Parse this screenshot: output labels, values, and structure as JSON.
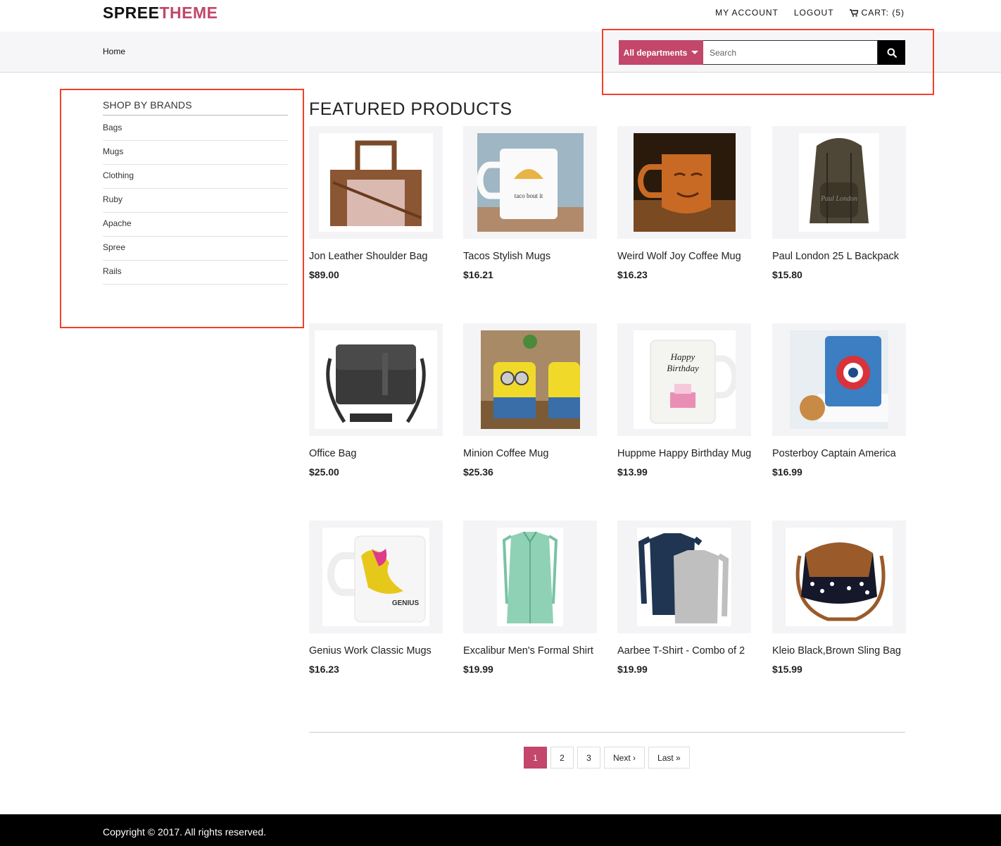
{
  "brand": {
    "part1": "SPREE",
    "part2": "THEME"
  },
  "top_links": {
    "account": "MY ACCOUNT",
    "logout": "LOGOUT",
    "cart": "CART: (5)"
  },
  "nav": {
    "home": "Home"
  },
  "search": {
    "department": "All departments",
    "placeholder": "Search"
  },
  "sidebar": {
    "title": "SHOP BY BRANDS",
    "items": [
      "Bags",
      "Mugs",
      "Clothing",
      "Ruby",
      "Apache",
      "Spree",
      "Rails"
    ]
  },
  "main": {
    "title": "FEATURED PRODUCTS"
  },
  "products": [
    {
      "name": "Jon Leather Shoulder Bag",
      "price": "$89.00",
      "icon": "shoulder-bag"
    },
    {
      "name": "Tacos Stylish Mugs",
      "price": "$16.21",
      "icon": "mug"
    },
    {
      "name": "Weird Wolf Joy Coffee Mug",
      "price": "$16.23",
      "icon": "mug"
    },
    {
      "name": "Paul London 25 L Backpack",
      "price": "$15.80",
      "icon": "backpack"
    },
    {
      "name": "Office Bag",
      "price": "$25.00",
      "icon": "messenger-bag"
    },
    {
      "name": "Minion Coffee Mug",
      "price": "$25.36",
      "icon": "mug"
    },
    {
      "name": "Huppme Happy Birthday Mug",
      "price": "$13.99",
      "icon": "mug"
    },
    {
      "name": "Posterboy Captain America",
      "price": "$16.99",
      "icon": "mug"
    },
    {
      "name": "Genius Work Classic Mugs",
      "price": "$16.23",
      "icon": "mug"
    },
    {
      "name": "Excalibur Men's Formal Shirt",
      "price": "$19.99",
      "icon": "shirt"
    },
    {
      "name": "Aarbee T-Shirt - Combo of 2",
      "price": "$19.99",
      "icon": "t-shirt"
    },
    {
      "name": "Kleio Black,Brown Sling Bag",
      "price": "$15.99",
      "icon": "sling-bag"
    }
  ],
  "pagination": {
    "pages": [
      "1",
      "2",
      "3"
    ],
    "next": "Next ›",
    "last": "Last »",
    "current": "1"
  },
  "footer": {
    "copyright": "Copyright © 2017. All rights reserved."
  },
  "colors": {
    "accent": "#c2476a",
    "highlight": "#f0402a"
  }
}
